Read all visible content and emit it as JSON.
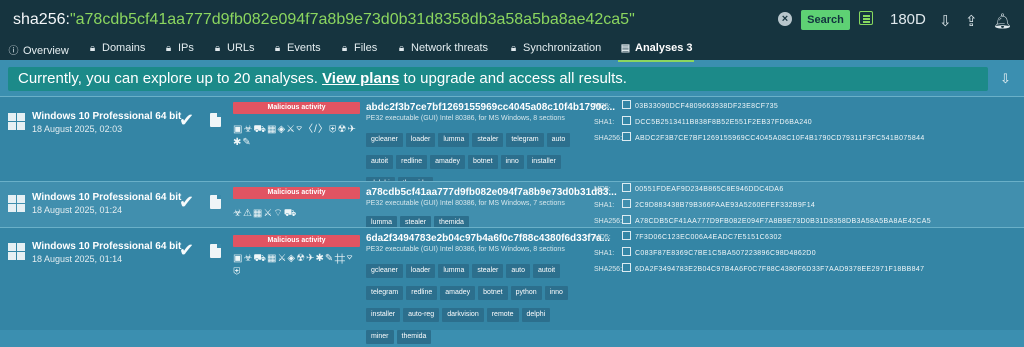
{
  "search": {
    "key": "sha256:",
    "value": "\"a78cdb5cf41aa777d9fb082e094f7a8b9e73d0b31d8358db3a58a5ba8ae42ca5\""
  },
  "top": {
    "search_label": "Search",
    "period": "180D"
  },
  "tabs": [
    {
      "label": "Overview"
    },
    {
      "label": "Domains"
    },
    {
      "label": "IPs"
    },
    {
      "label": "URLs"
    },
    {
      "label": "Events"
    },
    {
      "label": "Files"
    },
    {
      "label": "Network threats"
    },
    {
      "label": "Synchronization"
    },
    {
      "label": "Analyses 3"
    }
  ],
  "notice": {
    "prefix": "Currently, you can explore up to 20 analyses. ",
    "link": "View plans",
    "suffix": " to upgrade and access all results."
  },
  "rows": [
    {
      "os": "Windows 10 Professional 64 bit",
      "date": "18 August 2025, 02:03",
      "verdict": "Malicious activity",
      "hash": "abdc2f3b7ce7bf1269155969cc4045a08c10f4b1790c...",
      "sub": "PE32 executable (GUI) Intel 80386, for MS Windows, 8 sections",
      "tags": [
        "gcleaner",
        "loader",
        "lumma",
        "stealer",
        "telegram",
        "auto",
        "autoit",
        "redline",
        "amadey",
        "botnet",
        "inno",
        "installer",
        "delphi",
        "themida"
      ],
      "md5": "03B33090DCF4809663938DF23E8CF735",
      "sha1": "DCC5B2513411B838F8B52E551F2EB37FD6BA240",
      "sha256": "ABDC2F3B7CE7BF1269155969CC4045A08C10F4B1790CD79311F3FC541B075844"
    },
    {
      "os": "Windows 10 Professional 64 bit",
      "date": "18 August 2025, 01:24",
      "verdict": "Malicious activity",
      "hash": "a78cdb5cf41aa777d9fb082e094f7a8b9e73d0b31d83...",
      "sub": "PE32 executable (GUI) Intel 80386, for MS Windows, 7 sections",
      "tags": [
        "lumma",
        "stealer",
        "themida"
      ],
      "md5": "00551FDEAF9D234B865C8E946DDC4DA6",
      "sha1": "2C9D883438B79B366FAAE93A5260EFEF332B9F14",
      "sha256": "A78CDB5CF41AA777D9FB082E094F7A8B9E73D0B31D8358DB3A58A5BA8AE42CA5"
    },
    {
      "os": "Windows 10 Professional 64 bit",
      "date": "18 August 2025, 01:14",
      "verdict": "Malicious activity",
      "hash": "6da2f3494783e2b04c97b4a6f0c7f88c4380f6d33f7a...",
      "sub": "PE32 executable (GUI) Intel 80386, for MS Windows, 8 sections",
      "tags": [
        "gcleaner",
        "loader",
        "lumma",
        "stealer",
        "auto",
        "autoit",
        "telegram",
        "redline",
        "amadey",
        "botnet",
        "python",
        "inno",
        "installer",
        "auto-reg",
        "darkvision",
        "remote",
        "delphi",
        "miner",
        "themida"
      ],
      "md5": "7F3D06C123EC006A4EADC7E5151C6302",
      "sha1": "C083F87E8369C7BE1C5BA507223896C98D4862D0",
      "sha256": "6DA2F3494783E2B04C97B4A6F0C7F88C4380F6D33F7AAD9378EE2971F18BB847"
    }
  ],
  "icons": [
    "search-icon",
    "clear-icon",
    "yara-icon",
    "download-icon",
    "bell-icon",
    "info-icon",
    "lock-icon",
    "windows-icon",
    "check-icon",
    "file-icon",
    "copy-icon"
  ]
}
